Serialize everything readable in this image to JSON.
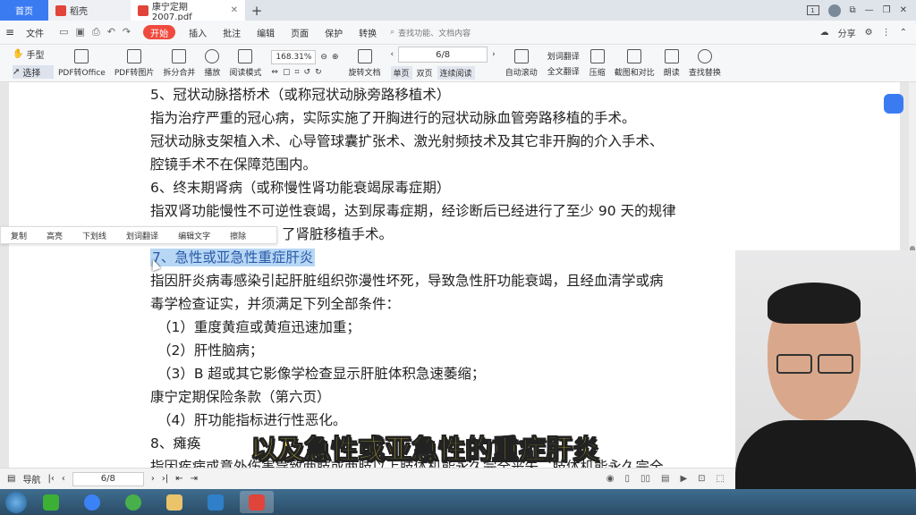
{
  "tabs": {
    "home": "首页",
    "doc": "稻壳",
    "pdf": "康宁定期2007.pdf",
    "add": "+"
  },
  "menubar": {
    "file": "文件",
    "start": "开始",
    "items": [
      "插入",
      "批注",
      "编辑",
      "页面",
      "保护",
      "转换"
    ],
    "search": "查找功能、文档内容",
    "share": "分享"
  },
  "toolbar": {
    "hand": "手型",
    "select": "选择",
    "pdf_office": "PDF转Office",
    "pdf_image": "PDF转图片",
    "split_merge": "拆分合并",
    "play": "播放",
    "read_mode": "阅读模式",
    "zoom": "168.31%",
    "rotate": "旋转文档",
    "page_indicator": "6/8",
    "single_page": "单页",
    "double_page": "双页",
    "continuous": "连续阅读",
    "auto_scroll": "自动滚动",
    "word_translate": "划词翻译",
    "full_translate": "全文翻译",
    "compress": "压缩",
    "screenshot": "截图和对比",
    "read_aloud": "朗读",
    "find_replace": "查找替换"
  },
  "context_menu": [
    "复制",
    "高亮",
    "下划线",
    "划词翻译",
    "编辑文字",
    "擦除"
  ],
  "document": {
    "lines": [
      "5、冠状动脉搭桥术（或称冠状动脉旁路移植术）",
      "指为治疗严重的冠心病，实际实施了开胸进行的冠状动脉血管旁路移植的手术。",
      "冠状动脉支架植入术、心导管球囊扩张术、激光射频技术及其它非开胸的介入手术、",
      "腔镜手术不在保障范围内。",
      "6、终末期肾病（或称慢性肾功能衰竭尿毒症期）",
      "指双肾功能慢性不可逆性衰竭，达到尿毒症期，经诊断后已经进行了至少 90 天的规律",
      "了肾脏移植手术。",
      "7、急性或亚急性重症肝炎",
      "指因肝炎病毒感染引起肝脏组织弥漫性坏死，导致急性肝功能衰竭，且经血清学或病",
      "毒学检查证实，并须满足下列全部条件：",
      "（1）重度黄疸或黄疸迅速加重；",
      "（2）肝性脑病；",
      "（3）B 超或其它影像学检查显示肝脏体积急速萎缩；",
      "康宁定期保险条款（第六页）",
      "（4）肝功能指标进行性恶化。",
      "8、瘫痪",
      "指因疾病或意外伤害导致两肢或两肢以上肢体机能永久完全丧失，肢体机能永久完全"
    ]
  },
  "subtitle": "以及急性或亚急性的重症肝炎",
  "statusbar": {
    "nav": "导航",
    "page": "6/8"
  }
}
